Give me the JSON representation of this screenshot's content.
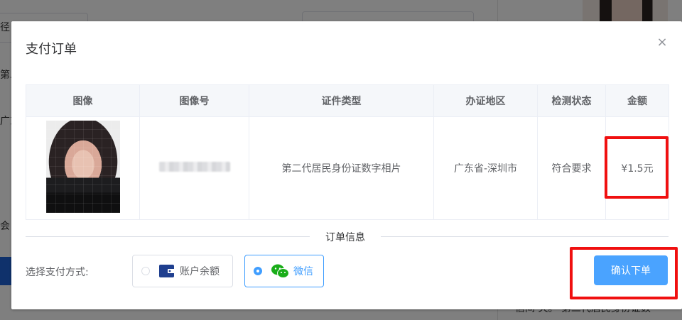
{
  "background": {
    "left_texts": [
      "径",
      "第二",
      "广东",
      "会"
    ],
    "bottom_text": "信间 天。 第二代居民身份证数"
  },
  "dialog": {
    "title": "支付订单",
    "close_label": "×"
  },
  "table": {
    "headers": [
      "图像",
      "图像号",
      "证件类型",
      "办证地区",
      "检测状态",
      "金额"
    ],
    "rows": [
      {
        "image_number": "",
        "id_type": "第二代居民身份证数字相片",
        "region": "广东省-深圳市",
        "status": "符合要求",
        "amount": "¥1.5元"
      }
    ]
  },
  "order_info_label": "订单信息",
  "payment": {
    "label": "选择支付方式:",
    "options": [
      {
        "label": "账户余额",
        "icon": "wallet-icon",
        "selected": false
      },
      {
        "label": "微信",
        "icon": "wechat-icon",
        "selected": true
      }
    ]
  },
  "confirm_label": "确认下单",
  "colors": {
    "primary": "#409eff",
    "button": "#4aa3ff",
    "highlight": "#f01010",
    "wechat_green": "#1aad19"
  }
}
